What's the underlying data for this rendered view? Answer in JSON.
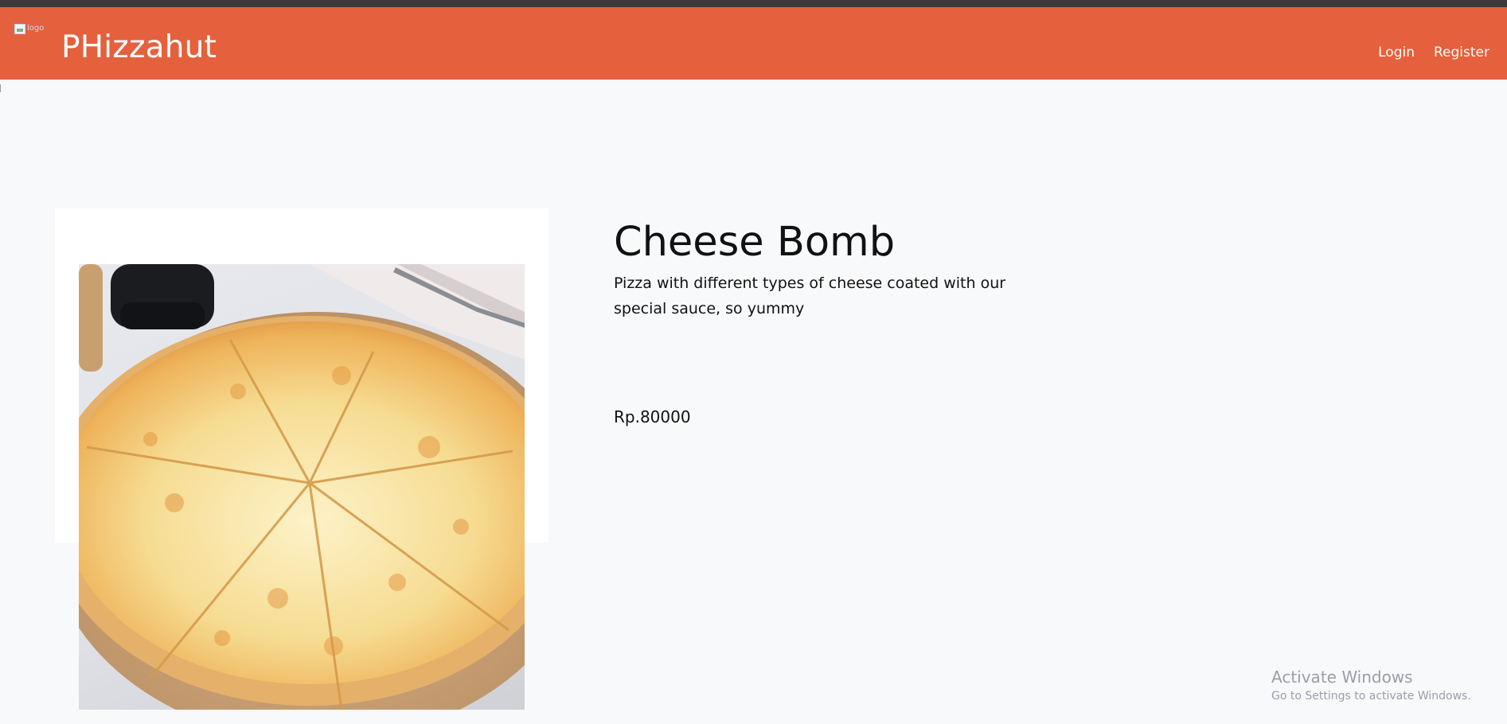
{
  "navbar": {
    "logo_alt": "logo",
    "brand": "PHizzahut",
    "links": [
      "Login",
      "Register"
    ],
    "color": "#e5603c"
  },
  "product": {
    "title": "Cheese Bomb",
    "description": "Pizza with different types of cheese coated with our special sauce, so yummy",
    "price": "Rp.80000",
    "image": "cheese-pizza-photo"
  },
  "watermark": {
    "line1": "Activate Windows",
    "line2": "Go to Settings to activate Windows."
  }
}
